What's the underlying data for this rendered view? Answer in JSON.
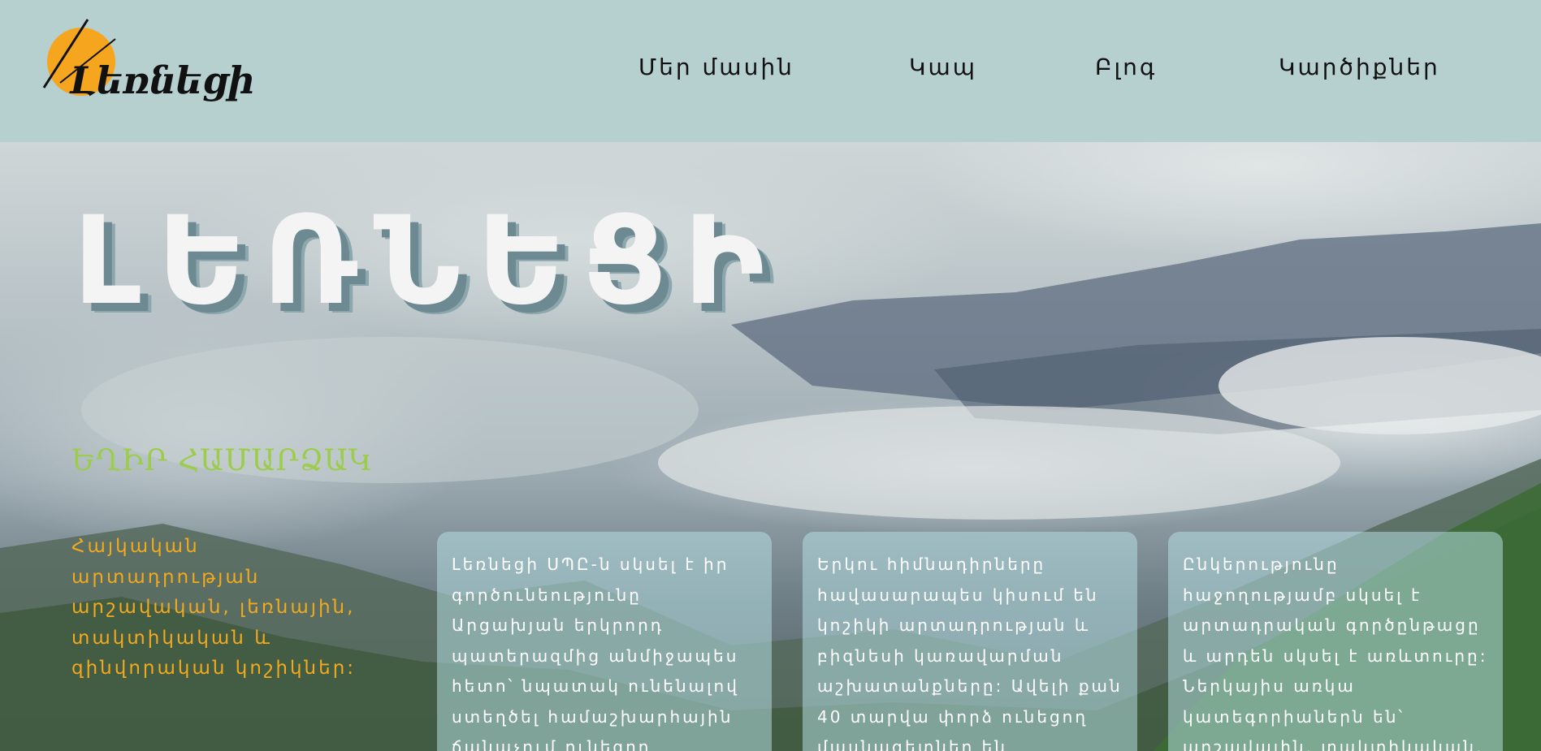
{
  "header": {
    "logo_text": "Լեռնեցի",
    "nav": [
      "Մեր մասին",
      "Կապ",
      "Բլոգ",
      "Կարծիքներ"
    ]
  },
  "hero": {
    "title": "ԼԵՌՆԵՑԻ",
    "subtitle": "ԵՂԻՐ ՀԱՄԱՐՁԱԿ",
    "tagline": "Հայկական արտադրության արշավական, լեռնային, տակտիկական և զինվորական կոշիկներ:",
    "cards": [
      "Լեռնեցի ՍՊԸ-ն սկսել է իր գործունեությունը Արցախյան երկրորդ պատերազմից անմիջապես հետո՝ նպատակ ունենալով ստեղծել համաշխարհային ճանաչում ունեցող հայկական բրենդ,",
      "Երկու հիմնադիրները հավասարապես կիսում են կոշիկի արտադրության և բիզնեսի կառավարման աշխատանքները: Ավելի քան 40 տարվա փորձ ունեցող մասնագետներ են ներգրավված",
      "Ընկերությունը հաջողությամբ սկսել է արտադրական գործընթացը և արդեն սկսել է առևտուրը: Ներկայիս առկա կատեգորիաներն են՝ արշավային, տակտիկական, զինվորական:"
    ]
  },
  "colors": {
    "header_bg": "#b6cfcf",
    "logo_accent": "#f5a61e",
    "subtitle": "#9bcc4a",
    "tagline": "#f3a91d"
  }
}
